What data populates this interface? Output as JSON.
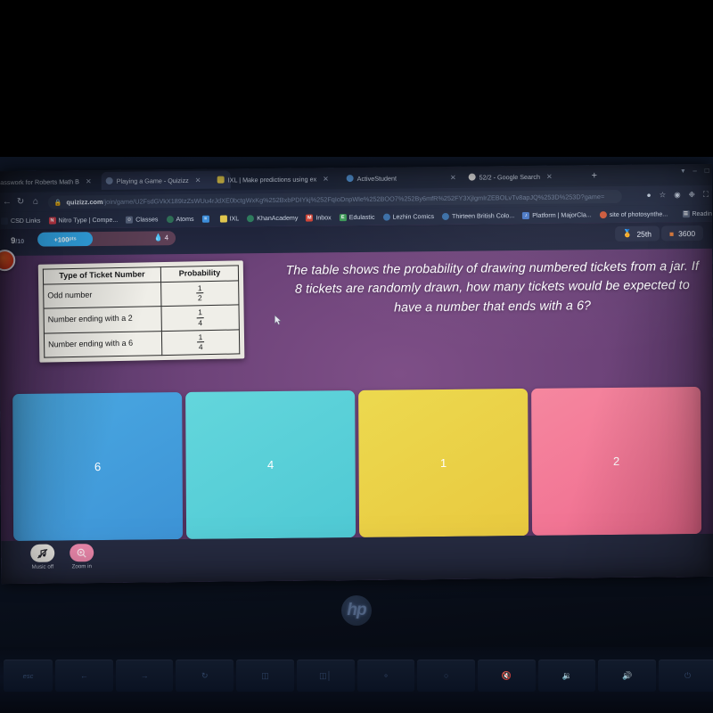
{
  "device": {
    "brand_logo": "hp",
    "keys": [
      "esc",
      "back-arrow",
      "forward-arrow",
      "reload",
      "fullscreen",
      "overview",
      "brightness-down",
      "brightness-up",
      "mute",
      "volume-down",
      "volume-up",
      "power"
    ]
  },
  "browser": {
    "tabs": [
      {
        "title": "lasswork for Roberts Math B",
        "active": false,
        "favicon_color": "#3d6ea8"
      },
      {
        "title": "Playing a Game - Quizizz",
        "active": true,
        "favicon_color": "#6a7da0"
      },
      {
        "title": "IXL | Make predictions using ex",
        "active": false,
        "favicon_color": "#d9c24a"
      },
      {
        "title": "ActiveStudent",
        "active": false,
        "favicon_color": "#4e8fd0"
      },
      {
        "title": "52/2 - Google Search",
        "active": false,
        "favicon_color": "#dcdcdc"
      }
    ],
    "new_tab_label": "+",
    "window_controls": [
      "minimize",
      "maximize",
      "close"
    ],
    "url_host": "quizizz.com",
    "url_path": "/join/game/U2FsdGVkX189IzZsWUu4rJdXE0bctgWxKg%252BxbPDIYkj%252FqIoDnpWle%252BOO7%252By6mfR%252FY3XjIgmIrZEBOLvTv8apJQ%253D%253D?game=",
    "url_lock_icon": "lock-icon",
    "omnibox_icons": [
      "location-pin-icon",
      "star-icon",
      "profile-icon",
      "extensions-icon",
      "cast-icon"
    ],
    "bookmarks": [
      {
        "label": "CSD Links",
        "icon_color": "#2b3550",
        "glyph": ""
      },
      {
        "label": "Nitro Type | Compe...",
        "icon_color": "#c93a4a",
        "glyph": "N"
      },
      {
        "label": "Classes",
        "icon_color": "#55617a",
        "glyph": "☰"
      },
      {
        "label": "Atoms",
        "icon_color": "#2f6f57",
        "glyph": "●"
      },
      {
        "label": "",
        "icon_color": "#3e8fdc",
        "glyph": "≡"
      },
      {
        "label": "IXL",
        "icon_color": "#e3c94f",
        "glyph": ""
      },
      {
        "label": "KhanAcademy",
        "icon_color": "#2f7d5f",
        "glyph": "●"
      },
      {
        "label": "Inbox",
        "icon_color": "#d04437",
        "glyph": "M"
      },
      {
        "label": "Edulastic",
        "icon_color": "#3d9a58",
        "glyph": "E"
      },
      {
        "label": "Lezhin Comics",
        "icon_color": "#3a6fa8",
        "glyph": "●"
      },
      {
        "label": "Thirteen British Colo...",
        "icon_color": "#3a6fa8",
        "glyph": "●"
      },
      {
        "label": "Platform | MajorCla...",
        "icon_color": "#4a79c7",
        "glyph": "♪"
      },
      {
        "label": "site of photosynthe...",
        "icon_color": "#cf5a3a",
        "glyph": "●"
      }
    ],
    "reading_list_label": "Readin"
  },
  "hud": {
    "question_progress": "9",
    "question_total": "/10",
    "points_label": "+100",
    "points_unit": "pts",
    "streak_icon": "flame-icon",
    "streak_count": "4",
    "rank_icon": "medal-icon",
    "rank_value": "25th",
    "coins_icon": "coin-icon",
    "coins_value": "3600"
  },
  "table": {
    "headers": [
      "Type of Ticket Number",
      "Probability"
    ],
    "rows": [
      {
        "label": "Odd number",
        "num": "1",
        "den": "2"
      },
      {
        "label": "Number ending with a 2",
        "num": "1",
        "den": "4"
      },
      {
        "label": "Number ending with a 6",
        "num": "1",
        "den": "4"
      }
    ]
  },
  "question": {
    "text": "The table shows the probability of drawing numbered tickets from a jar. If 8 tickets are randomly drawn, how many tickets would be expected to have a number that ends with a 6?"
  },
  "answers": [
    {
      "label": "6",
      "color": "#4aa9e2"
    },
    {
      "label": "4",
      "color": "#63d6dc"
    },
    {
      "label": "1",
      "color": "#ecd94f"
    },
    {
      "label": "2",
      "color": "#f5879f"
    }
  ],
  "controls": [
    {
      "label": "Music off",
      "icon": "music-off-icon"
    },
    {
      "label": "Zoom in",
      "icon": "zoom-in-icon"
    }
  ]
}
